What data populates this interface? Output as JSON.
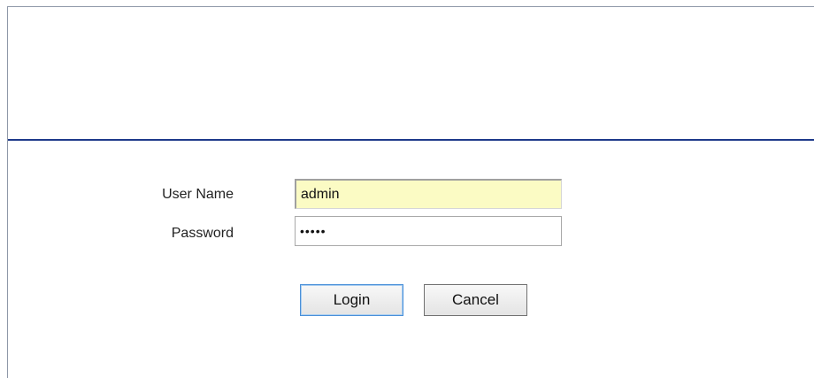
{
  "login_form": {
    "username_label": "User Name",
    "username_value": "admin",
    "password_label": "Password",
    "password_value": "•••••",
    "login_button": "Login",
    "cancel_button": "Cancel"
  },
  "colors": {
    "divider": "#1e3a8a",
    "username_field_bg": "#fbfbc4",
    "login_button_focus_border": "#4a90d9"
  }
}
